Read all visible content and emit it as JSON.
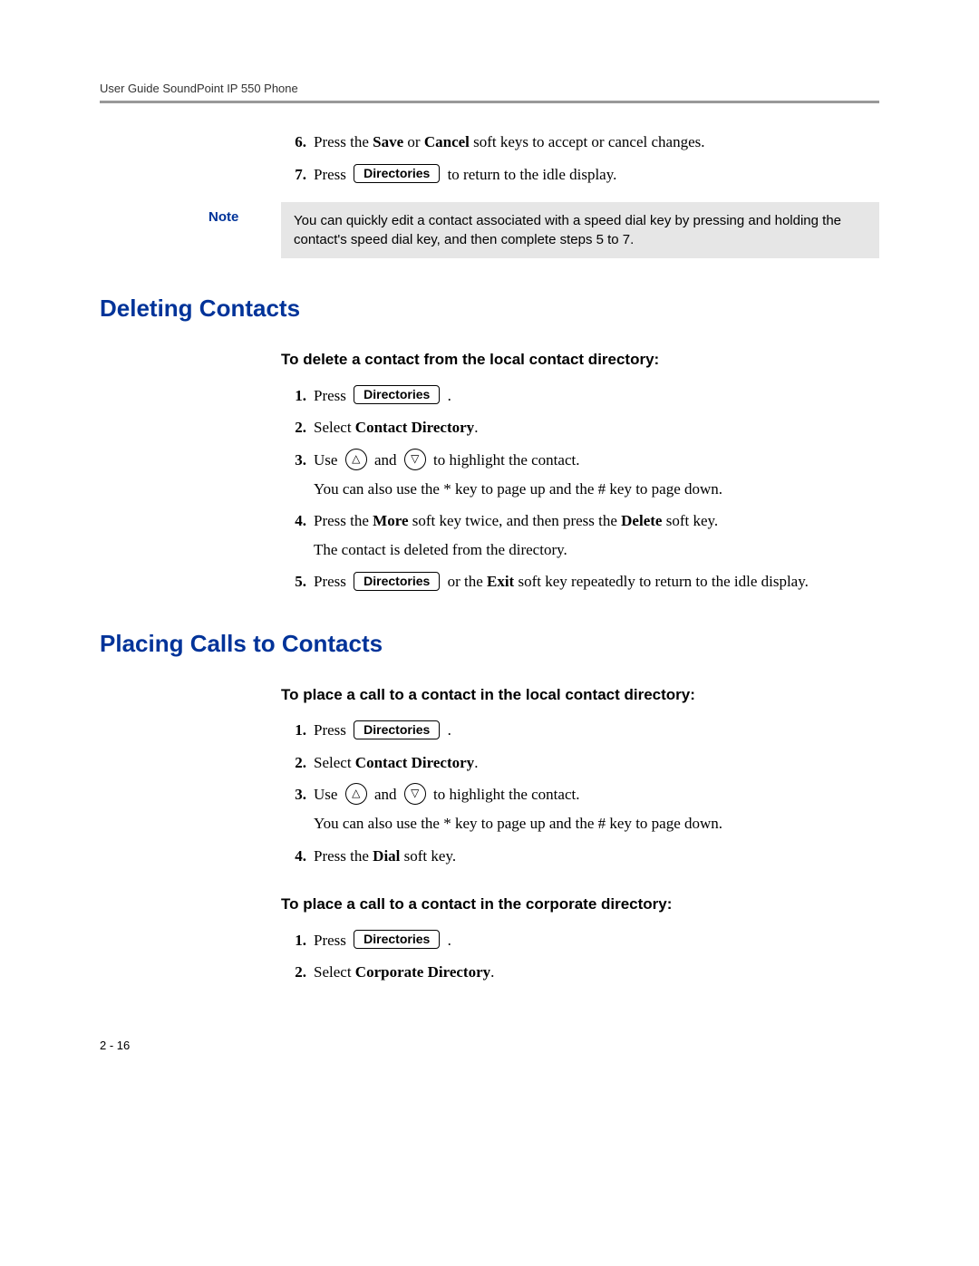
{
  "header": "User Guide SoundPoint IP 550 Phone",
  "btn_label": "Directories",
  "top_steps": {
    "s6_num": "6.",
    "s6_a": "Press the ",
    "s6_b": "Save",
    "s6_c": " or ",
    "s6_d": "Cancel",
    "s6_e": " soft keys to accept or cancel changes.",
    "s7_num": "7.",
    "s7_a": "Press ",
    "s7_b": " to return to the idle display."
  },
  "note": {
    "label": "Note",
    "text": "You can quickly edit a contact associated with a speed dial key by pressing and holding the contact's speed dial key, and then complete steps 5 to 7."
  },
  "sec_delete": {
    "title": "Deleting Contacts",
    "task": "To delete a contact from the local contact directory:",
    "s1_num": "1.",
    "s1_a": "Press ",
    "s1_b": " .",
    "s2_num": "2.",
    "s2_a": "Select ",
    "s2_b": "Contact Directory",
    "s2_c": ".",
    "s3_num": "3.",
    "s3_a": "Use ",
    "s3_b": " and ",
    "s3_c": " to highlight the contact.",
    "s3_d": "You can also use the * key to page up and the # key to page down.",
    "s4_num": "4.",
    "s4_a": "Press the ",
    "s4_b": "More",
    "s4_c": " soft key twice, and then press the ",
    "s4_d": "Delete",
    "s4_e": " soft key.",
    "s4_f": "The contact is deleted from the directory.",
    "s5_num": "5.",
    "s5_a": "Press ",
    "s5_b": " or the ",
    "s5_c": "Exit",
    "s5_d": " soft key repeatedly to return to the idle display."
  },
  "sec_place": {
    "title": "Placing Calls to Contacts",
    "task_local": "To place a call to a contact in the local contact directory:",
    "l1_num": "1.",
    "l1_a": "Press ",
    "l1_b": " .",
    "l2_num": "2.",
    "l2_a": "Select ",
    "l2_b": "Contact Directory",
    "l2_c": ".",
    "l3_num": "3.",
    "l3_a": "Use ",
    "l3_b": " and ",
    "l3_c": " to highlight the contact.",
    "l3_d": "You can also use the * key to page up and the # key to page down.",
    "l4_num": "4.",
    "l4_a": "Press the ",
    "l4_b": "Dial",
    "l4_c": " soft key.",
    "task_corp": "To place a call to a contact in the corporate directory:",
    "c1_num": "1.",
    "c1_a": "Press ",
    "c1_b": " .",
    "c2_num": "2.",
    "c2_a": "Select ",
    "c2_b": "Corporate Directory",
    "c2_c": "."
  },
  "page_number": "2 - 16",
  "arrow_up": "△",
  "arrow_down": "▽"
}
